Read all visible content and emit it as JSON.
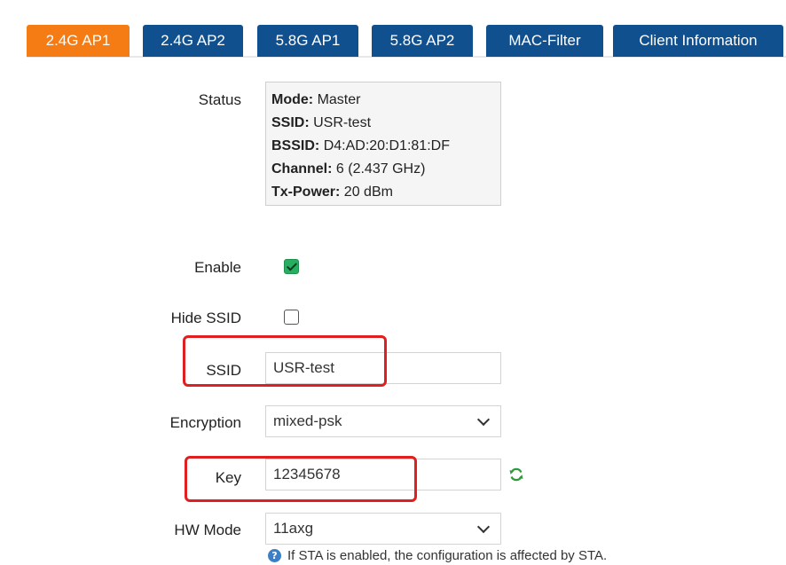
{
  "tabs": [
    {
      "label": "2.4G AP1",
      "active": true
    },
    {
      "label": "2.4G AP2",
      "active": false
    },
    {
      "label": "5.8G AP1",
      "active": false
    },
    {
      "label": "5.8G AP2",
      "active": false
    },
    {
      "label": "MAC-Filter",
      "active": false
    },
    {
      "label": "Client Information",
      "active": false
    }
  ],
  "status": {
    "label": "Status",
    "mode_key": "Mode:",
    "mode_val": "Master",
    "ssid_key": "SSID:",
    "ssid_val": "USR-test",
    "bssid_key": "BSSID:",
    "bssid_val": "D4:AD:20:D1:81:DF",
    "channel_key": "Channel:",
    "channel_val": "6 (2.437 GHz)",
    "txpower_key": "Tx-Power:",
    "txpower_val": "20 dBm"
  },
  "enable": {
    "label": "Enable",
    "checked": true
  },
  "hide_ssid": {
    "label": "Hide SSID",
    "checked": false
  },
  "ssid": {
    "label": "SSID",
    "value": "USR-test"
  },
  "encryption": {
    "label": "Encryption",
    "value": "mixed-psk"
  },
  "key": {
    "label": "Key",
    "value": "12345678"
  },
  "hw_mode": {
    "label": "HW Mode",
    "value": "11axg"
  },
  "hint": {
    "text": "If STA is enabled, the configuration is affected by STA."
  },
  "colors": {
    "tab_active": "#f57c14",
    "tab_inactive": "#10508f",
    "checkbox_checked": "#27ae60",
    "highlight": "#e02020"
  }
}
